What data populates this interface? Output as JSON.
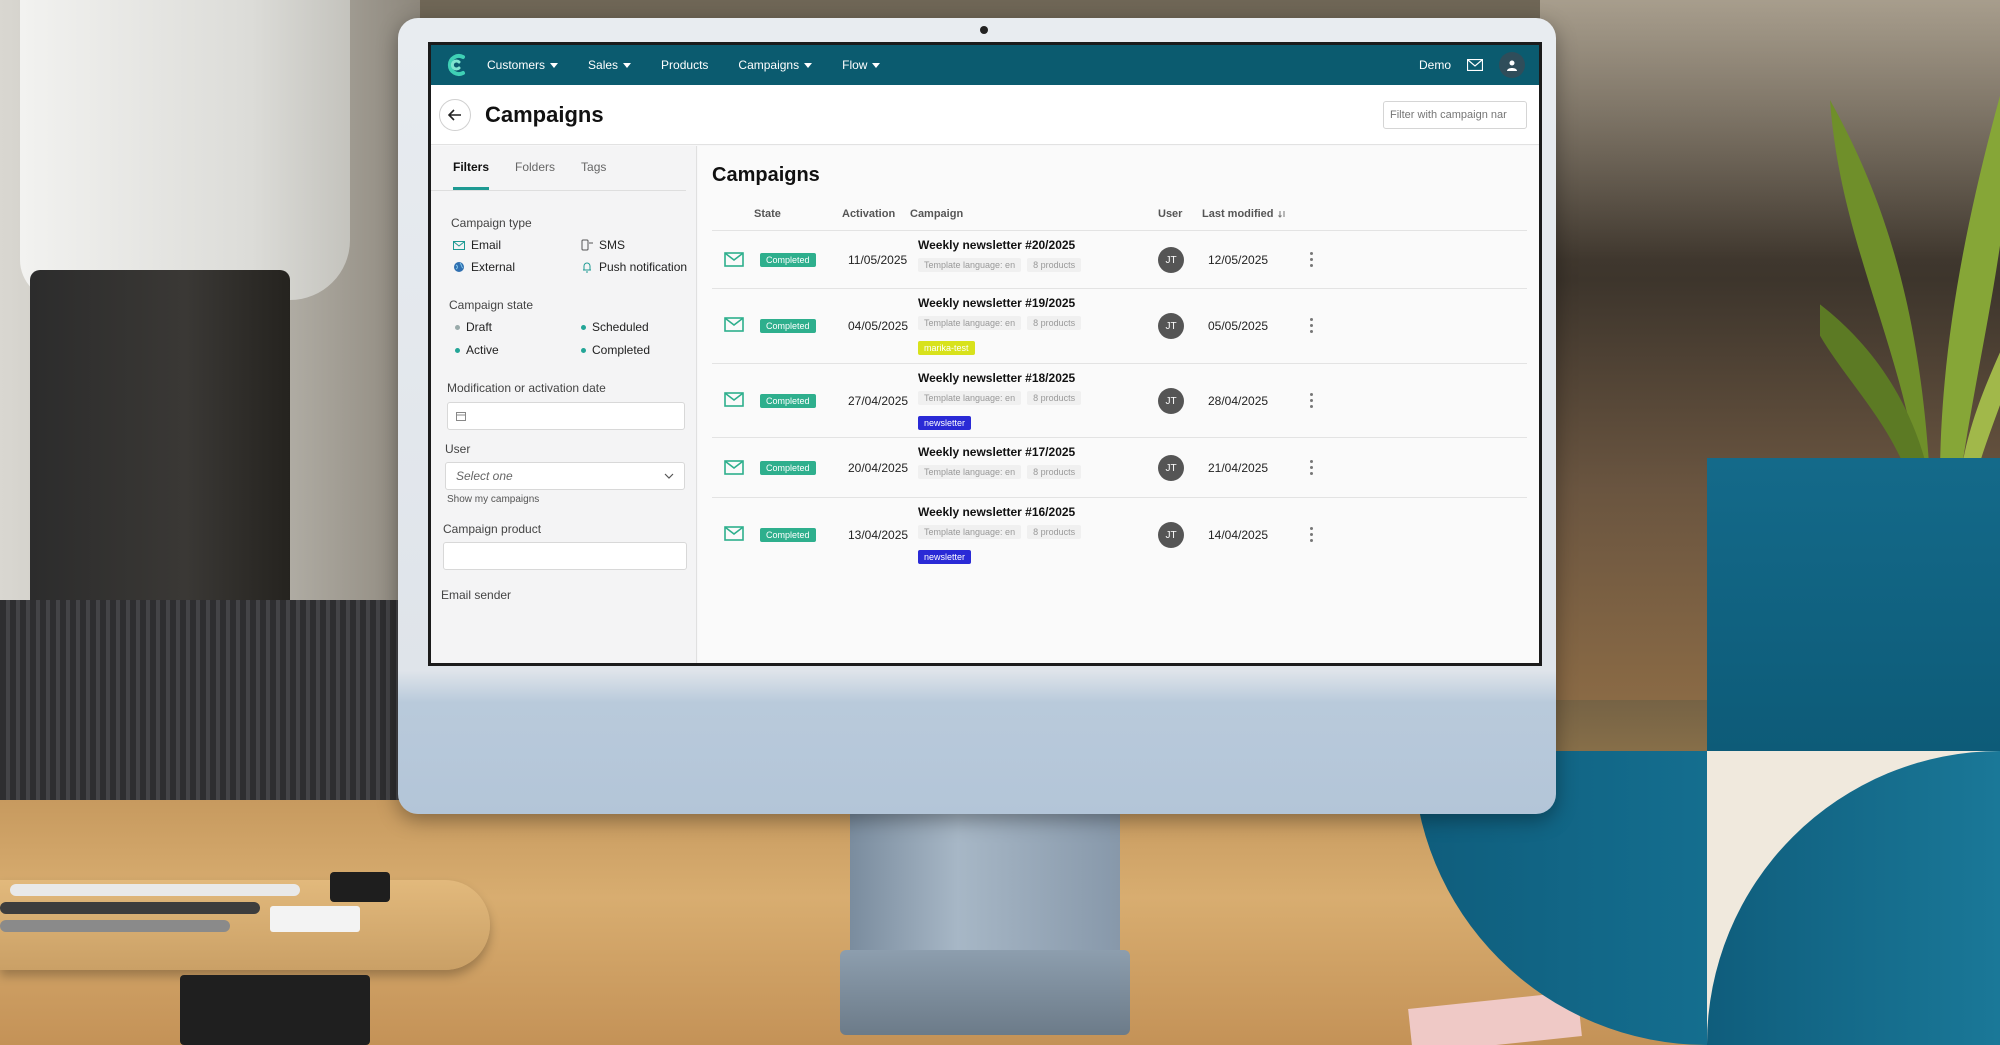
{
  "colors": {
    "nav_bg": "#0b5b6f",
    "accent_teal": "#1e9a93",
    "status_completed": "#2eaf8d",
    "tag_yellow": "#d8e21c",
    "tag_blue": "#2a2ad6",
    "deco_teal": "#0f5d7c"
  },
  "nav": {
    "items": [
      {
        "label": "Customers",
        "dropdown": true
      },
      {
        "label": "Sales",
        "dropdown": true
      },
      {
        "label": "Products",
        "dropdown": false
      },
      {
        "label": "Campaigns",
        "dropdown": true
      },
      {
        "label": "Flow",
        "dropdown": true
      }
    ],
    "account_label": "Demo",
    "icons": [
      "mail-icon",
      "user-icon"
    ]
  },
  "header": {
    "title": "Campaigns",
    "filter_placeholder": "Filter with campaign nar"
  },
  "sidebar": {
    "tabs": [
      {
        "label": "Filters",
        "active": true
      },
      {
        "label": "Folders",
        "active": false
      },
      {
        "label": "Tags",
        "active": false
      }
    ],
    "campaign_type": {
      "label": "Campaign type",
      "options": [
        {
          "label": "Email",
          "icon": "mail-icon"
        },
        {
          "label": "SMS",
          "icon": "sms-icon"
        },
        {
          "label": "External",
          "icon": "globe-icon"
        },
        {
          "label": "Push notification",
          "icon": "bell-icon"
        }
      ]
    },
    "campaign_state": {
      "label": "Campaign state",
      "options": [
        "Draft",
        "Scheduled",
        "Active",
        "Completed"
      ]
    },
    "date_label": "Modification or activation date",
    "user_label": "User",
    "user_select_value": "Select one",
    "show_my_campaigns": "Show my campaigns",
    "product_label": "Campaign product",
    "email_sender_label": "Email sender"
  },
  "main": {
    "title": "Campaigns",
    "columns": {
      "state": "State",
      "activation": "Activation",
      "campaign": "Campaign",
      "user": "User",
      "last_modified": "Last modified"
    },
    "rows": [
      {
        "state": "Completed",
        "activation": "11/05/2025",
        "name": "Weekly newsletter #20/2025",
        "language": "Template language: en",
        "products": "8 products",
        "tag": "",
        "user": "JT",
        "modified": "12/05/2025"
      },
      {
        "state": "Completed",
        "activation": "04/05/2025",
        "name": "Weekly newsletter #19/2025",
        "language": "Template language: en",
        "products": "8 products",
        "tag": "marika-test",
        "user": "JT",
        "modified": "05/05/2025"
      },
      {
        "state": "Completed",
        "activation": "27/04/2025",
        "name": "Weekly newsletter #18/2025",
        "language": "Template language: en",
        "products": "8 products",
        "tag": "newsletter",
        "user": "JT",
        "modified": "28/04/2025"
      },
      {
        "state": "Completed",
        "activation": "20/04/2025",
        "name": "Weekly newsletter #17/2025",
        "language": "Template language: en",
        "products": "8 products",
        "tag": "",
        "user": "JT",
        "modified": "21/04/2025"
      },
      {
        "state": "Completed",
        "activation": "13/04/2025",
        "name": "Weekly newsletter #16/2025",
        "language": "Template language: en",
        "products": "8 products",
        "tag": "newsletter",
        "user": "JT",
        "modified": "14/04/2025"
      }
    ]
  }
}
